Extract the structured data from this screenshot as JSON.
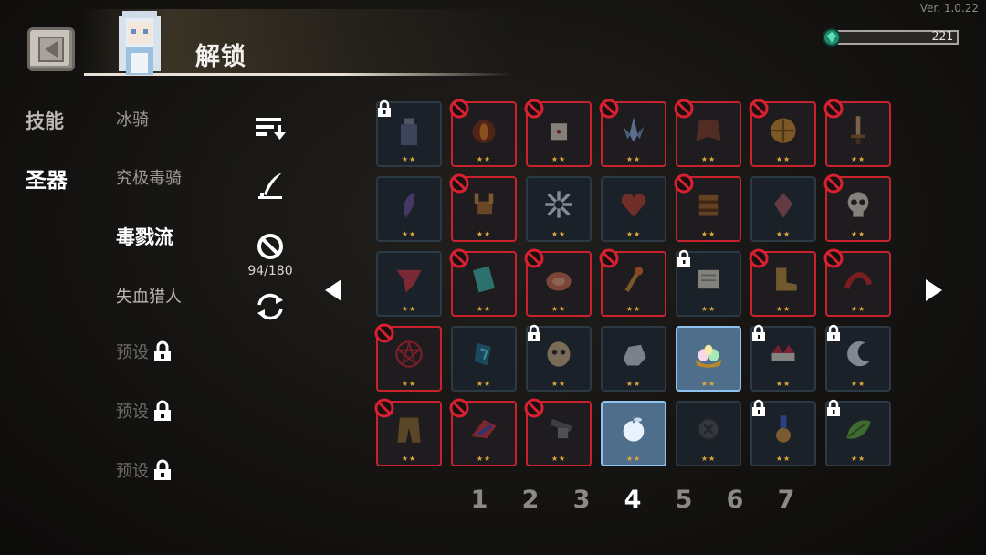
{
  "header": {
    "title": "解锁",
    "version": "Ver. 1.0.22"
  },
  "currency": {
    "gem_count": "221",
    "icon": "gem-icon"
  },
  "left_nav": {
    "categories": [
      {
        "label": "技能"
      },
      {
        "label": "圣器"
      }
    ],
    "builds": [
      {
        "label": "冰骑"
      },
      {
        "label": "究极毒骑"
      },
      {
        "label": "毒戮流"
      },
      {
        "label": "失血猎人"
      }
    ],
    "presets": [
      {
        "label": "预设"
      },
      {
        "label": "预设"
      },
      {
        "label": "预设"
      }
    ]
  },
  "tools": {
    "ban_count": "94/180"
  },
  "grid": {
    "rows": [
      [
        {
          "state": "locked",
          "item": "bottle"
        },
        {
          "state": "banned",
          "item": "eye"
        },
        {
          "state": "banned",
          "item": "dice"
        },
        {
          "state": "banned",
          "item": "crystal"
        },
        {
          "state": "banned",
          "item": "cloak"
        },
        {
          "state": "banned",
          "item": "shield"
        },
        {
          "state": "banned",
          "item": "sword"
        }
      ],
      [
        {
          "state": "normal",
          "item": "feather"
        },
        {
          "state": "banned",
          "item": "deer"
        },
        {
          "state": "normal",
          "item": "snowflake"
        },
        {
          "state": "normal",
          "item": "heart"
        },
        {
          "state": "banned",
          "item": "barrel"
        },
        {
          "state": "normal",
          "item": "gem"
        },
        {
          "state": "banned",
          "item": "skull"
        }
      ],
      [
        {
          "state": "normal",
          "item": "scarf"
        },
        {
          "state": "banned",
          "item": "card"
        },
        {
          "state": "banned",
          "item": "meat"
        },
        {
          "state": "banned",
          "item": "staff"
        },
        {
          "state": "locked",
          "item": "scroll"
        },
        {
          "state": "banned",
          "item": "boot"
        },
        {
          "state": "banned",
          "item": "claw"
        }
      ],
      [
        {
          "state": "banned",
          "item": "pentagram"
        },
        {
          "state": "normal",
          "item": "rune"
        },
        {
          "state": "locked",
          "item": "mask"
        },
        {
          "state": "normal",
          "item": "rock"
        },
        {
          "state": "selected",
          "item": "eggs"
        },
        {
          "state": "locked",
          "item": "crown"
        },
        {
          "state": "locked",
          "item": "crescent"
        }
      ],
      [
        {
          "state": "banned",
          "item": "pants"
        },
        {
          "state": "banned",
          "item": "wing"
        },
        {
          "state": "banned",
          "item": "arm"
        },
        {
          "state": "selected",
          "item": "apple"
        },
        {
          "state": "normal",
          "item": "coin"
        },
        {
          "state": "locked",
          "item": "medal"
        },
        {
          "state": "locked",
          "item": "leaf"
        }
      ]
    ],
    "stars": "★★"
  },
  "pagination": {
    "pages": [
      "1",
      "2",
      "3",
      "4",
      "5",
      "6",
      "7"
    ],
    "current": "4"
  }
}
